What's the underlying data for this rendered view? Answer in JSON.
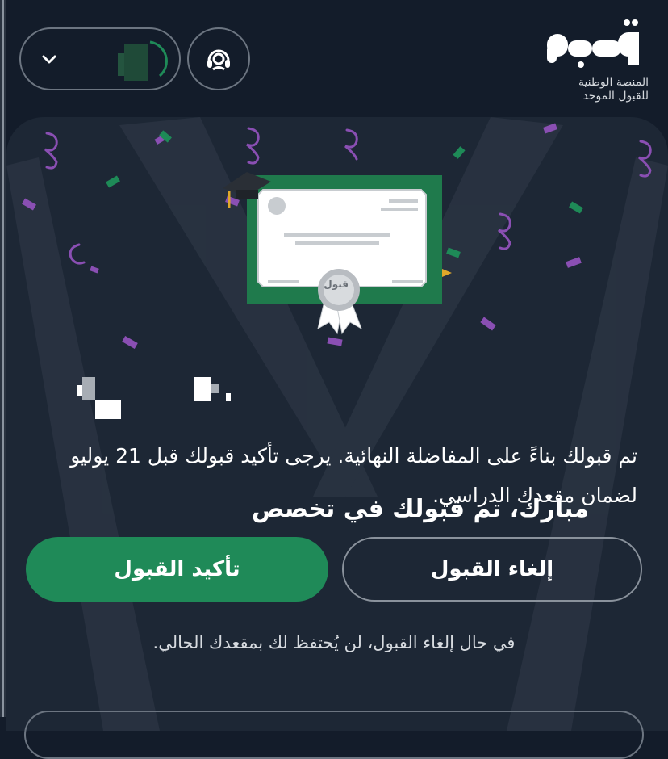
{
  "brand": {
    "logo_text": "قبول",
    "tagline_line1": "المنصة الوطنية",
    "tagline_line2": "للقبول الموحد"
  },
  "header": {
    "support_icon": "headset-icon",
    "user_menu_icon": "chevron-down-icon",
    "progress_ring_color": "#1f8a58"
  },
  "certificate": {
    "seal_text": "قبول",
    "cap_icon": "graduation-cap-icon"
  },
  "main": {
    "headline": "مبارك، تم قبولك في تخصص",
    "message": "تم قبولك بناءً على المفاضلة النهائية. يرجى تأكيد قبولك قبل 21 يوليو لضمان مقعدك الدراسي.",
    "confirm_label": "تأكيد القبول",
    "cancel_label": "إلغاء القبول",
    "note": "في حال إلغاء القبول، لن يُحتفظ لك بمقعدك الحالي."
  },
  "colors": {
    "background": "#131c2a",
    "card": "#1d2735",
    "accent_green": "#1f8a58",
    "confetti_purple": "#8a4fb3",
    "confetti_green": "#1e8a57"
  }
}
